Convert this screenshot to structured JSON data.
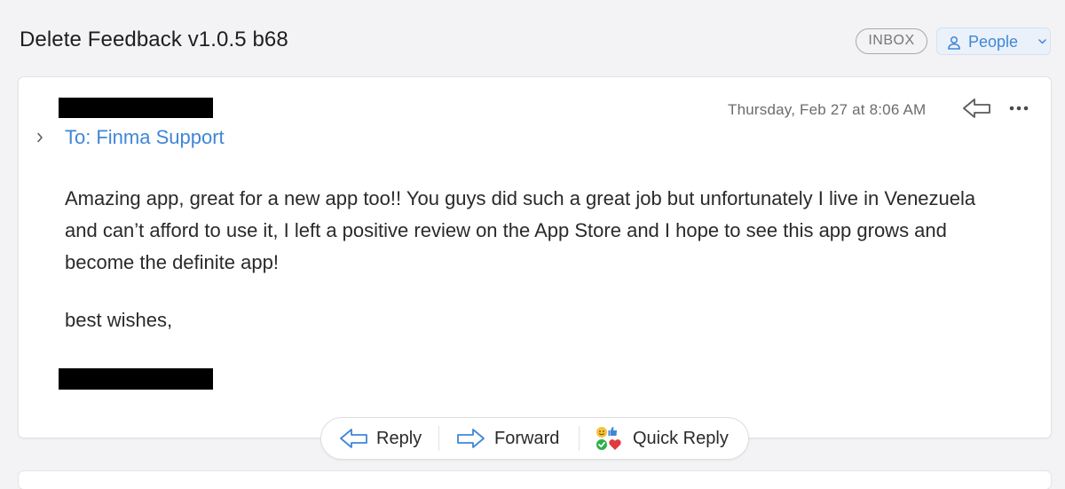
{
  "header": {
    "subject": "Delete Feedback v1.0.5 b68",
    "mailbox_badge": "INBOX",
    "people_button": "People",
    "people_icon": "person-icon",
    "people_chevron": "chevron-down-icon"
  },
  "message": {
    "to_prefix": "To:",
    "to_name": "Finma Support",
    "date": "Thursday, Feb 27 at 8:06 AM",
    "body_paragraphs": [
      "Amazing app, great for a new app too!! You guys did such a great job but unfortunately I live in Venezuela and can’t afford to use it, I left a positive review on the App Store and I hope to see this app grows and become the definite app!",
      "best wishes,"
    ]
  },
  "actions": {
    "reply_label": "Reply",
    "forward_label": "Forward",
    "quick_reply_label": "Quick Reply"
  },
  "colors": {
    "accent": "#3f87d6",
    "background": "#f3f3f5",
    "card": "#ffffff",
    "redaction": "#000000"
  }
}
